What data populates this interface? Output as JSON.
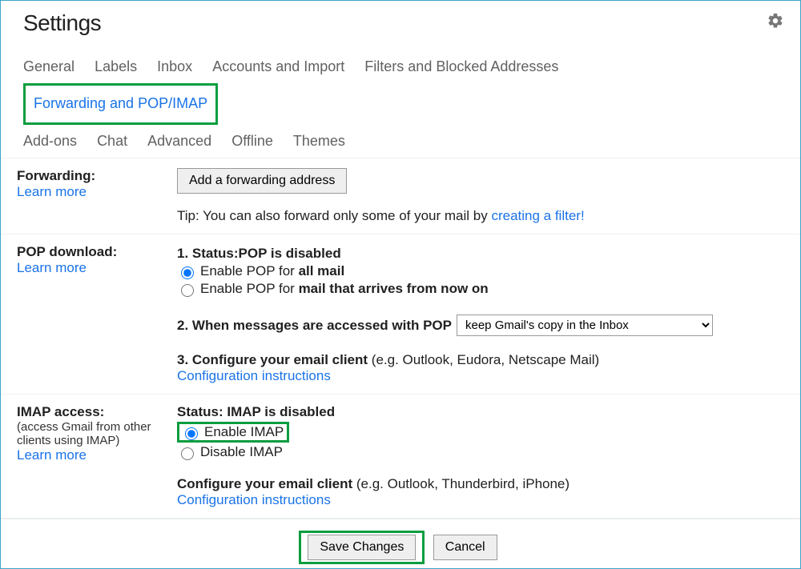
{
  "title": "Settings",
  "tabs": {
    "general": "General",
    "labels": "Labels",
    "inbox": "Inbox",
    "accounts": "Accounts and Import",
    "filters": "Filters and Blocked Addresses",
    "forwarding": "Forwarding and POP/IMAP",
    "addons": "Add-ons",
    "chat": "Chat",
    "advanced": "Advanced",
    "offline": "Offline",
    "themes": "Themes"
  },
  "forwarding": {
    "heading": "Forwarding:",
    "learn": "Learn more",
    "add_button": "Add a forwarding address",
    "tip_prefix": "Tip: You can also forward only some of your mail by ",
    "tip_link": "creating a filter!"
  },
  "pop": {
    "heading": "POP download:",
    "learn": "Learn more",
    "item1_prefix": "1. Status: ",
    "item1_status": "POP is disabled",
    "radio1_prefix": "Enable POP for ",
    "radio1_bold": "all mail",
    "radio2_prefix": "Enable POP for ",
    "radio2_bold": "mail that arrives from now on",
    "item2_label": "2. When messages are accessed with POP",
    "select_value": "keep Gmail's copy in the Inbox",
    "item3_prefix": "3. Configure your email client ",
    "item3_paren": "(e.g. Outlook, Eudora, Netscape Mail)",
    "config_link": "Configuration instructions"
  },
  "imap": {
    "heading": "IMAP access:",
    "sub": "(access Gmail from other clients using IMAP)",
    "learn": "Learn more",
    "status_prefix": "Status: ",
    "status_value": "IMAP is disabled",
    "enable_label": "Enable IMAP",
    "disable_label": "Disable IMAP",
    "config_prefix": "Configure your email client ",
    "config_paren": "(e.g. Outlook, Thunderbird, iPhone)",
    "config_link": "Configuration instructions"
  },
  "footer": {
    "save": "Save Changes",
    "cancel": "Cancel"
  }
}
